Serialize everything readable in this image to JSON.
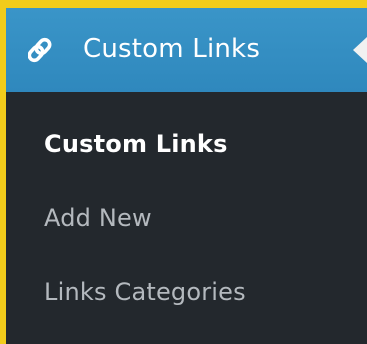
{
  "menu": {
    "title": "Custom Links",
    "icon": "link-icon",
    "items": [
      {
        "label": "Custom Links",
        "current": true
      },
      {
        "label": "Add New",
        "current": false
      },
      {
        "label": "Links Categories",
        "current": false
      }
    ]
  },
  "colors": {
    "border": "#f2cc1b",
    "header_bg": "#3a95c8",
    "menu_bg": "#23282d",
    "active_text": "#ffffff",
    "inactive_text": "#b4b9be"
  }
}
